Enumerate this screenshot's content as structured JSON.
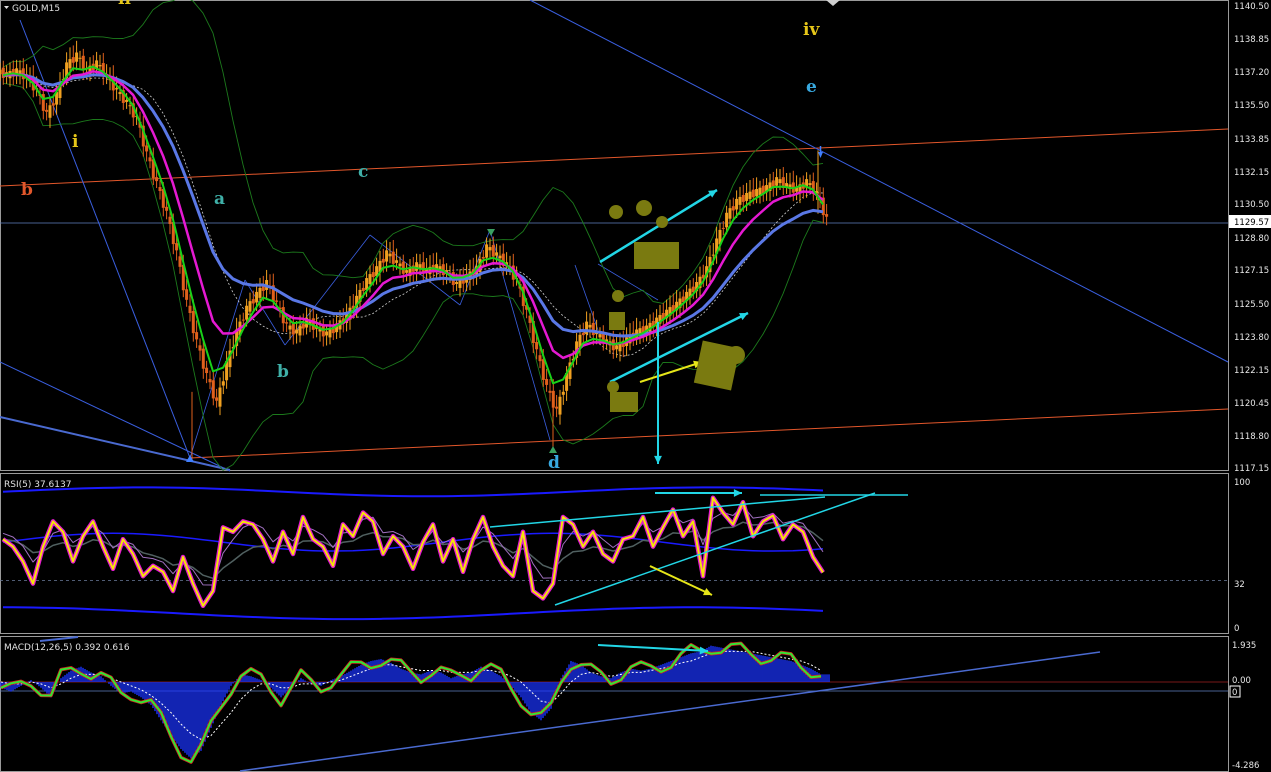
{
  "window": {
    "symbol_label": "GOLD,M15"
  },
  "price_axis": {
    "ticks": [
      "1140.50",
      "1138.85",
      "1137.20",
      "1135.50",
      "1133.85",
      "1132.15",
      "1130.50",
      "1128.80",
      "1127.15",
      "1125.50",
      "1123.80",
      "1122.15",
      "1120.45",
      "1118.80",
      "1117.15"
    ],
    "current_price": "1129.57"
  },
  "rsi": {
    "label": "RSI(5) 37.6137",
    "ticks": [
      "100",
      "32",
      "0"
    ],
    "level": "32"
  },
  "macd": {
    "label": "MACD(12,26,5) 0.392 0.616",
    "ticks": [
      "1.935",
      "0.00",
      "-4.286"
    ],
    "marker": "0"
  },
  "wave_labels": [
    {
      "text": "ii",
      "color": "#e6c619"
    },
    {
      "text": "iv",
      "color": "#e6c619"
    },
    {
      "text": "e",
      "color": "#38a9e0"
    },
    {
      "text": "i",
      "color": "#e6c619"
    },
    {
      "text": "b",
      "color": "#e2572b"
    },
    {
      "text": "a",
      "color": "#3fb0a8"
    },
    {
      "text": "c",
      "color": "#3fb0a8"
    },
    {
      "text": "b",
      "color": "#3fb0a8"
    },
    {
      "text": "d",
      "color": "#38a9e0"
    }
  ],
  "colors": {
    "bg": "#000000",
    "candle": "#e8821e",
    "ma_fast": "#19d119",
    "ma_mid": "#e519d2",
    "ma_slow": "#5a78e6",
    "channel": "#e2572b",
    "trend": "#3a5fe0",
    "arrow_cyan": "#22d6e6",
    "arrow_yellow": "#e6e619",
    "rsi_line": "#f5e50a",
    "macd_hist": "#1a34ff",
    "macd_line": "#33e633"
  },
  "chart_data": [
    {
      "type": "candlestick",
      "title": "GOLD,M15",
      "ylim": [
        1117.15,
        1140.5
      ],
      "grid": false,
      "x": [
        0,
        10,
        20,
        30,
        40,
        50,
        60,
        70,
        80,
        90,
        100,
        110,
        120,
        130,
        140,
        150,
        160,
        170,
        180,
        190,
        200,
        210,
        220,
        230,
        240,
        250,
        260,
        270,
        280,
        290,
        300,
        310,
        320,
        330,
        340,
        350,
        360,
        370,
        380,
        390,
        400,
        410,
        420,
        430,
        440,
        450,
        460,
        470,
        480,
        490,
        500,
        510,
        520,
        530,
        540,
        550,
        560,
        570,
        580,
        590,
        600,
        610,
        620,
        630,
        640,
        650,
        660,
        670,
        680,
        690,
        700,
        710,
        720,
        730,
        740,
        750,
        760,
        770,
        780,
        790,
        800,
        810,
        820
      ],
      "close": [
        1137.0,
        1137.2,
        1136.9,
        1136.2,
        1135.0,
        1136.0,
        1137.5,
        1138.0,
        1137.2,
        1137.6,
        1136.9,
        1136.2,
        1135.6,
        1134.8,
        1133.0,
        1131.5,
        1130.0,
        1128.0,
        1125.5,
        1123.5,
        1121.8,
        1120.4,
        1122.4,
        1124.0,
        1125.2,
        1125.9,
        1126.5,
        1125.4,
        1124.3,
        1124.0,
        1124.6,
        1124.2,
        1123.9,
        1124.3,
        1124.8,
        1125.7,
        1126.6,
        1127.2,
        1128.0,
        1127.5,
        1127.0,
        1127.4,
        1127.1,
        1127.3,
        1127.0,
        1126.4,
        1126.8,
        1127.2,
        1128.3,
        1127.9,
        1127.4,
        1126.6,
        1125.0,
        1123.0,
        1121.2,
        1120.0,
        1121.8,
        1123.4,
        1124.4,
        1123.9,
        1123.5,
        1123.2,
        1123.6,
        1124.0,
        1124.2,
        1124.6,
        1125.0,
        1125.4,
        1125.9,
        1126.4,
        1127.2,
        1128.6,
        1129.9,
        1130.6,
        1130.9,
        1131.1,
        1131.3,
        1131.7,
        1131.4,
        1131.2,
        1131.6,
        1131.0,
        1129.7
      ]
    },
    {
      "type": "line",
      "title": "RSI(5) 37.6137",
      "ylim": [
        0,
        100
      ],
      "level": 32,
      "values": [
        60,
        55,
        45,
        30,
        55,
        72,
        65,
        45,
        62,
        72,
        55,
        40,
        60,
        50,
        35,
        42,
        38,
        25,
        48,
        30,
        15,
        25,
        68,
        65,
        72,
        70,
        60,
        45,
        65,
        50,
        75,
        60,
        55,
        42,
        70,
        62,
        78,
        72,
        50,
        62,
        55,
        40,
        58,
        70,
        45,
        60,
        38,
        60,
        75,
        55,
        42,
        35,
        65,
        25,
        20,
        30,
        75,
        70,
        55,
        65,
        50,
        45,
        60,
        62,
        75,
        55,
        68,
        80,
        62,
        72,
        35,
        88,
        78,
        70,
        85,
        62,
        72,
        76,
        60,
        70,
        65,
        48,
        37.6
      ]
    },
    {
      "type": "bar",
      "title": "MACD(12,26,5) 0.392 0.616",
      "ylim": [
        -4.286,
        1.935
      ],
      "values": [
        -0.3,
        -0.5,
        -0.2,
        0.1,
        -0.3,
        -0.8,
        0.2,
        0.6,
        0.8,
        0.5,
        0.3,
        -0.2,
        -0.6,
        -0.5,
        -0.8,
        -1.2,
        -2.0,
        -2.8,
        -3.5,
        -4.0,
        -3.6,
        -2.4,
        -1.2,
        -0.2,
        0.4,
        0.3,
        0.1,
        -0.3,
        -0.8,
        -0.3,
        0.2,
        -0.1,
        -0.2,
        0.1,
        0.3,
        0.6,
        0.9,
        1.1,
        1.2,
        1.0,
        0.7,
        0.5,
        0.4,
        0.6,
        0.5,
        0.2,
        0.4,
        0.5,
        0.8,
        0.6,
        0.3,
        -0.2,
        -0.8,
        -1.6,
        -2.0,
        -1.4,
        0.2,
        1.1,
        0.9,
        0.5,
        0.3,
        0.2,
        0.5,
        0.7,
        0.6,
        0.7,
        0.9,
        1.1,
        1.3,
        1.5,
        1.6,
        1.9,
        1.8,
        1.7,
        1.6,
        1.5,
        1.4,
        1.3,
        1.2,
        1.1,
        0.9,
        0.7,
        0.4
      ],
      "signal": [
        0.0,
        -0.1,
        -0.1,
        0.0,
        -0.1,
        -0.3,
        -0.1,
        0.2,
        0.4,
        0.4,
        0.4,
        0.2,
        0.0,
        -0.2,
        -0.4,
        -0.7,
        -1.1,
        -1.6,
        -2.2,
        -2.7,
        -3.0,
        -2.8,
        -2.2,
        -1.6,
        -0.9,
        -0.4,
        -0.1,
        -0.1,
        -0.3,
        -0.3,
        -0.1,
        -0.1,
        -0.1,
        0.0,
        0.1,
        0.3,
        0.5,
        0.7,
        0.9,
        0.9,
        0.8,
        0.7,
        0.6,
        0.6,
        0.6,
        0.5,
        0.5,
        0.5,
        0.6,
        0.6,
        0.5,
        0.3,
        0.0,
        -0.5,
        -1.0,
        -1.1,
        -0.6,
        0.0,
        0.4,
        0.5,
        0.4,
        0.3,
        0.4,
        0.5,
        0.5,
        0.6,
        0.7,
        0.8,
        1.0,
        1.1,
        1.3,
        1.5,
        1.6,
        1.6,
        1.6,
        1.6,
        1.5,
        1.4,
        1.3,
        1.2,
        1.1,
        0.9,
        0.6
      ]
    }
  ]
}
